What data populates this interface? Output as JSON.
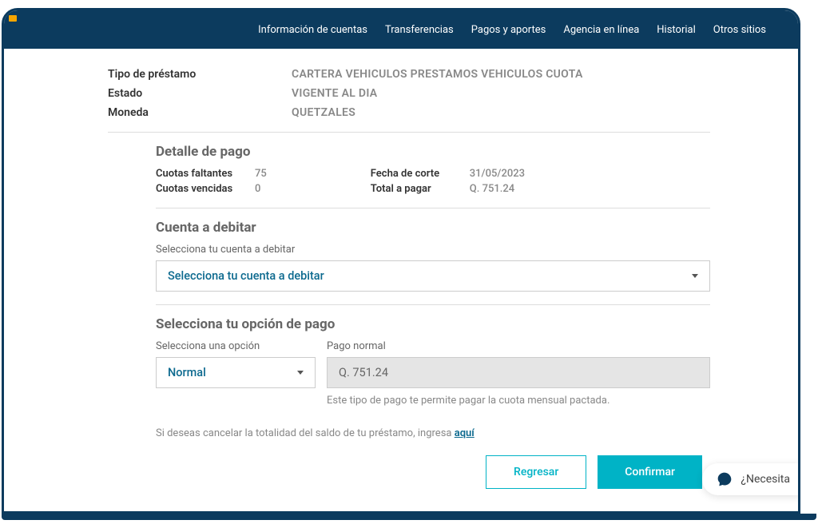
{
  "nav": {
    "items": [
      "Información de cuentas",
      "Transferencias",
      "Pagos y aportes",
      "Agencia en línea",
      "Historial",
      "Otros sitios"
    ]
  },
  "loan": {
    "type_label": "Tipo de préstamo",
    "type_value": "CARTERA VEHICULOS PRESTAMOS VEHICULOS CUOTA",
    "status_label": "Estado",
    "status_value": "VIGENTE AL DIA",
    "currency_label": "Moneda",
    "currency_value": "QUETZALES"
  },
  "detail": {
    "title": "Detalle de pago",
    "pending_label": "Cuotas faltantes",
    "pending_value": "75",
    "overdue_label": "Cuotas vencidas",
    "overdue_value": "0",
    "cutoff_label": "Fecha de corte",
    "cutoff_value": "31/05/2023",
    "total_label": "Total a pagar",
    "total_value": "Q. 751.24"
  },
  "debit": {
    "title": "Cuenta a debitar",
    "field_label": "Selecciona tu cuenta a debitar",
    "selected": "Selecciona tu cuenta a debitar"
  },
  "option": {
    "title": "Selecciona tu opción de pago",
    "select_label": "Selecciona una opción",
    "selected": "Normal",
    "amount_label": "Pago normal",
    "amount_value": "Q. 751.24",
    "help": "Este tipo de pago te permite pagar la cuota mensual pactada."
  },
  "cancel_note": {
    "prefix": "Si deseas cancelar la totalidad del saldo de tu préstamo, ingresa ",
    "link": "aquí"
  },
  "actions": {
    "back": "Regresar",
    "confirm": "Confirmar"
  },
  "chat": {
    "text": "¿Necesita"
  }
}
